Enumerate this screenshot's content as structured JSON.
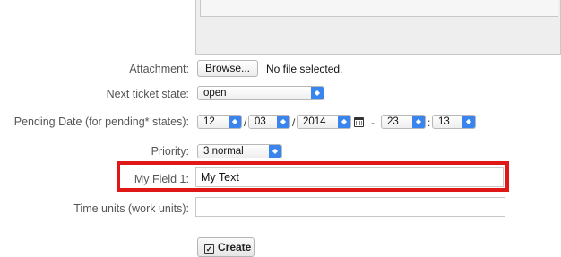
{
  "labels": {
    "attachment": "Attachment:",
    "next_state": "Next ticket state:",
    "pending": "Pending Date (for pending* states):",
    "priority": "Priority:",
    "my_field": "My Field 1:",
    "time_units": "Time units (work units):"
  },
  "attachment": {
    "browse_label": "Browse...",
    "status": "No file selected."
  },
  "next_state": {
    "value": "open"
  },
  "pending_date": {
    "day": "12",
    "month": "03",
    "year": "2014",
    "hour": "23",
    "minute": "13",
    "sep_slash": "/",
    "sep_dash": "-",
    "sep_colon": ":"
  },
  "priority": {
    "value": "3 normal"
  },
  "my_field": {
    "value": "My Text"
  },
  "time_units": {
    "value": ""
  },
  "create_label": "Create",
  "colors": {
    "accent": "#3a84ef",
    "highlight": "#e01717"
  },
  "icons": [
    "select-arrows-icon",
    "calendar-icon",
    "checkbox-icon"
  ]
}
